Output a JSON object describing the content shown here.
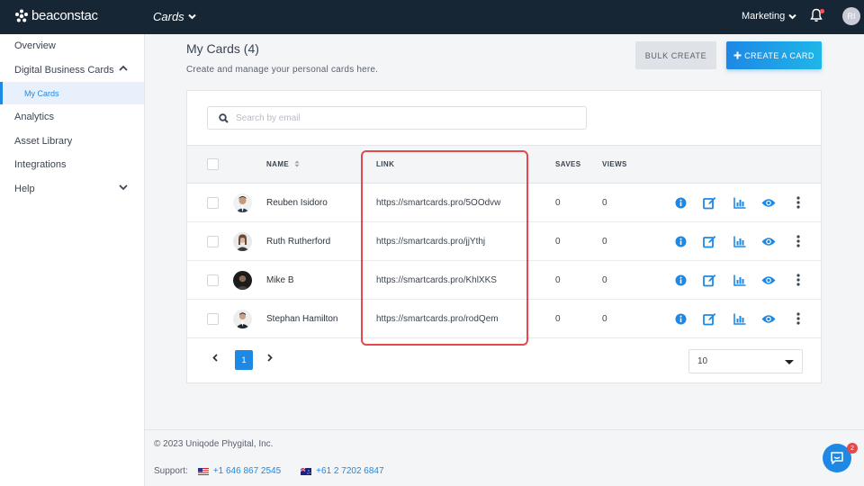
{
  "topbar": {
    "logo_text": "beaconstac",
    "product": "Cards",
    "org": "Marketing",
    "avatar_initials": "RI"
  },
  "sidebar": {
    "items": [
      {
        "label": "Overview"
      },
      {
        "label": "Digital Business Cards"
      },
      {
        "label": "Analytics"
      },
      {
        "label": "Asset Library"
      },
      {
        "label": "Integrations"
      },
      {
        "label": "Help"
      }
    ],
    "sub_item": "My Cards"
  },
  "header": {
    "title": "My Cards (4)",
    "subtitle": "Create and manage your personal cards here.",
    "bulk_create_label": "BULK CREATE",
    "create_label": "CREATE A CARD"
  },
  "search": {
    "placeholder": "Search by email"
  },
  "table": {
    "columns": [
      "NAME",
      "LINK",
      "SAVES",
      "VIEWS"
    ],
    "rows": [
      {
        "name": "Reuben Isidoro",
        "link": "https://smartcards.pro/5OOdvw",
        "saves": "0",
        "views": "0"
      },
      {
        "name": "Ruth Rutherford",
        "link": "https://smartcards.pro/jjYthj",
        "saves": "0",
        "views": "0"
      },
      {
        "name": "Mike B",
        "link": "https://smartcards.pro/KhlXKS",
        "saves": "0",
        "views": "0"
      },
      {
        "name": "Stephan Hamilton",
        "link": "https://smartcards.pro/rodQem",
        "saves": "0",
        "views": "0"
      }
    ]
  },
  "pagination": {
    "current_page": "1",
    "per_page": "10"
  },
  "footer": {
    "copyright": "© 2023 Uniqode Phygital, Inc.",
    "support_label": "Support:",
    "phone_us": "+1 646 867 2545",
    "phone_au": "+61 2 7202 6847"
  },
  "chat": {
    "badge_count": "2"
  },
  "colors": {
    "accent": "#1e88e5",
    "topbar": "#172635",
    "highlight": "#e5484d"
  }
}
